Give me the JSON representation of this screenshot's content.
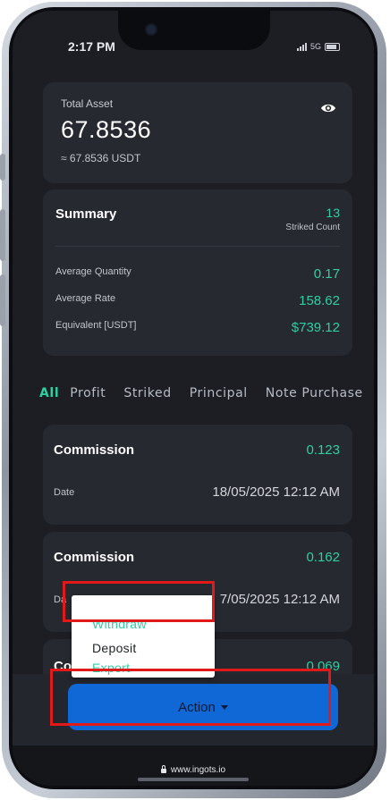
{
  "status_bar": {
    "time": "2:17 PM",
    "network": "5G",
    "icons": [
      "signal-icon",
      "battery-icon"
    ]
  },
  "asset": {
    "label": "Total Asset",
    "value": "67.8536",
    "sub": "≈ 67.8536 USDT",
    "icon": "eye-icon"
  },
  "summary": {
    "title": "Summary",
    "count": "13",
    "count_label": "Striked Count",
    "rows": [
      {
        "label": "Average Quantity",
        "value": "0.17"
      },
      {
        "label": "Average Rate",
        "value": "158.62"
      },
      {
        "label": "Equivalent [USDT]",
        "value": "$739.12"
      }
    ]
  },
  "tabs": [
    {
      "label": "All",
      "active": true
    },
    {
      "label": "Profit"
    },
    {
      "label": "Striked"
    },
    {
      "label": "Principal"
    },
    {
      "label": "Note Purchase"
    }
  ],
  "transactions": [
    {
      "title": "Commission",
      "amount": "0.123",
      "date_label": "Date",
      "date": "18/05/2025 12:12 AM"
    },
    {
      "title": "Commission",
      "amount": "0.162",
      "date_label": "Da",
      "date": "7/05/2025 12:12 AM"
    },
    {
      "title": "Co",
      "amount": "0.069"
    }
  ],
  "action_menu": {
    "items": [
      {
        "label": "Withdraw",
        "color": "#2ecfa3"
      },
      {
        "label": "Deposit",
        "color": "#1e2128"
      },
      {
        "label": "Export",
        "color": "#2ecfa3"
      }
    ]
  },
  "action_button": {
    "label": "Action"
  },
  "footer": {
    "url": "www.ingots.io"
  },
  "colors": {
    "accent": "#2ecfa3",
    "button": "#0f68d6",
    "highlight": "#e11919",
    "background": "#1c1e24"
  }
}
